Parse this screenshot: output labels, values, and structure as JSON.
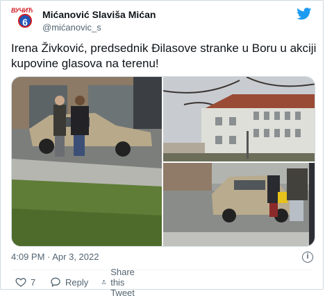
{
  "author": {
    "name": "Mićanović Slaviša Mićan",
    "handle": "@mićanovic_s",
    "avatar_text": "ВУЧИЋ",
    "avatar_number": "6"
  },
  "tweet": {
    "text": "Irena Živković, predsednik Đilasove stranke u Boru u akciji kupovine glasova na terenu!"
  },
  "meta": {
    "timestamp": "4:09 PM · Apr 3, 2022"
  },
  "actions": {
    "like_count": "7",
    "reply_label": "Reply",
    "share_label": "Share this Tweet"
  },
  "colors": {
    "twitter_blue": "#1d9bf0",
    "text_secondary": "#536471",
    "like_red": "#f91880"
  }
}
